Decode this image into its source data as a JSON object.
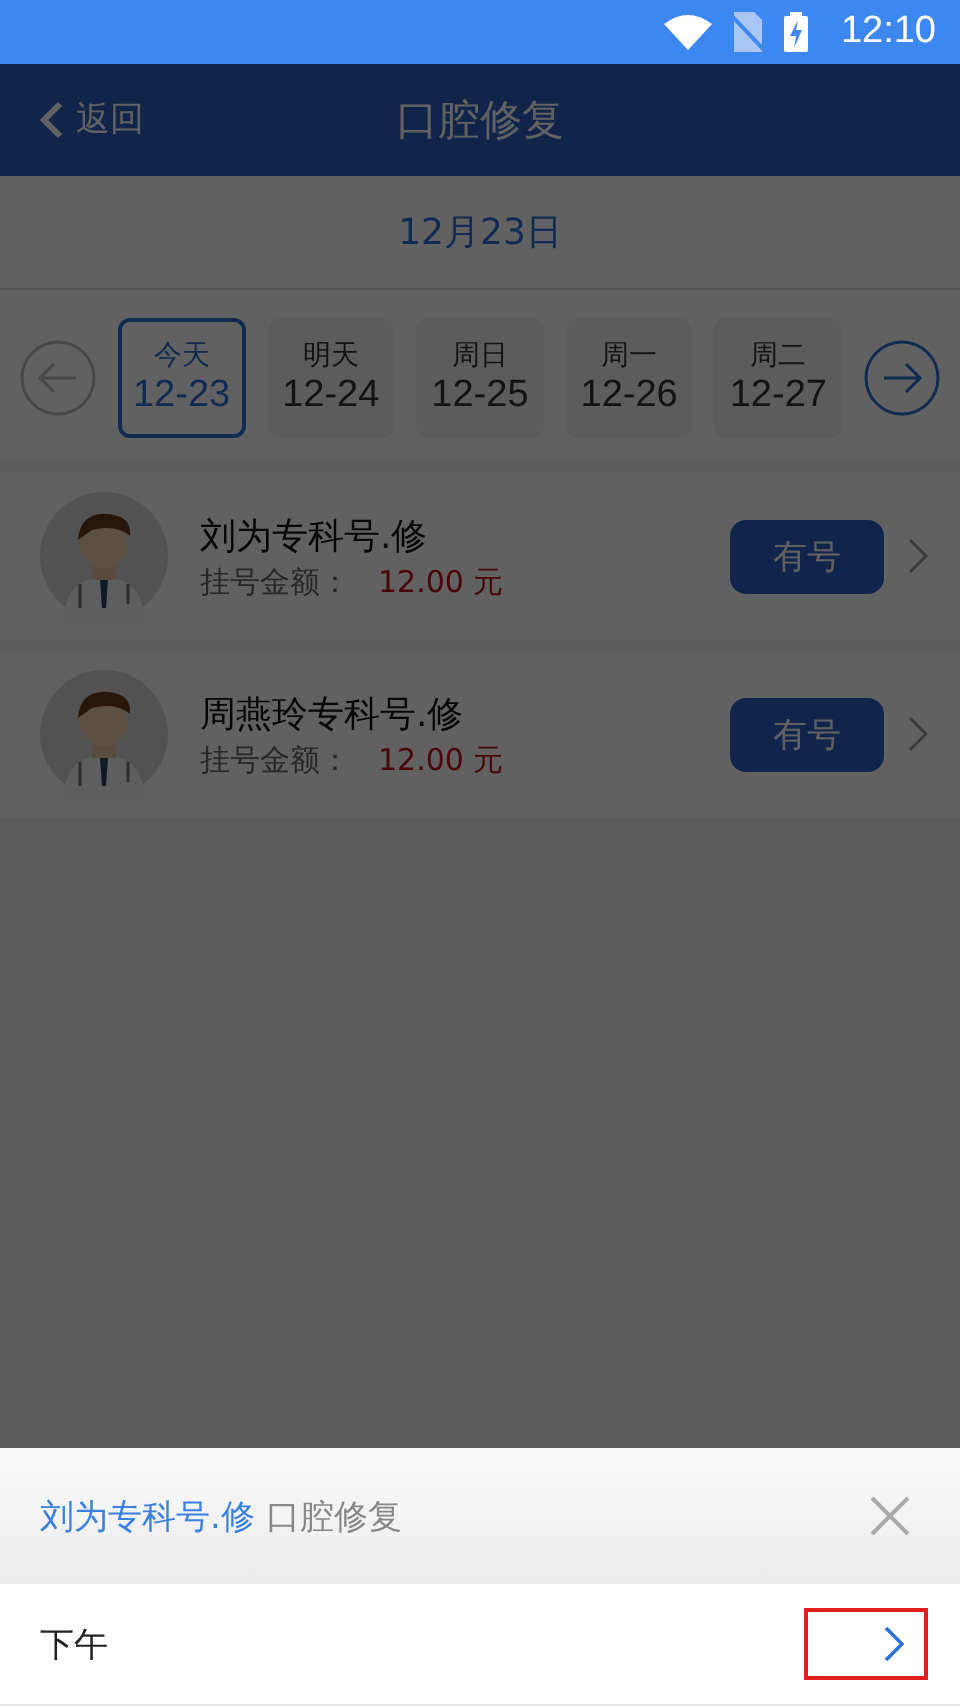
{
  "status_bar": {
    "time": "12:10"
  },
  "header": {
    "back": "返回",
    "title": "口腔修复"
  },
  "date_heading": "12月23日",
  "day_picker": {
    "prev_enabled": false,
    "next_enabled": true,
    "days": [
      {
        "label": "今天",
        "date": "12-23",
        "selected": true
      },
      {
        "label": "明天",
        "date": "12-24",
        "selected": false
      },
      {
        "label": "周日",
        "date": "12-25",
        "selected": false
      },
      {
        "label": "周一",
        "date": "12-26",
        "selected": false
      },
      {
        "label": "周二",
        "date": "12-27",
        "selected": false
      }
    ]
  },
  "doctors": [
    {
      "name": "刘为专科号.修",
      "fee_label": "挂号金额：",
      "fee": "12.00 元",
      "status": "有号"
    },
    {
      "name": "周燕玲专科号.修",
      "fee_label": "挂号金额：",
      "fee": "12.00 元",
      "status": "有号"
    }
  ],
  "sheet": {
    "doctor": "刘为专科号.修",
    "department": "口腔修复",
    "rows": [
      {
        "label": "下午",
        "highlighted": true
      }
    ]
  }
}
